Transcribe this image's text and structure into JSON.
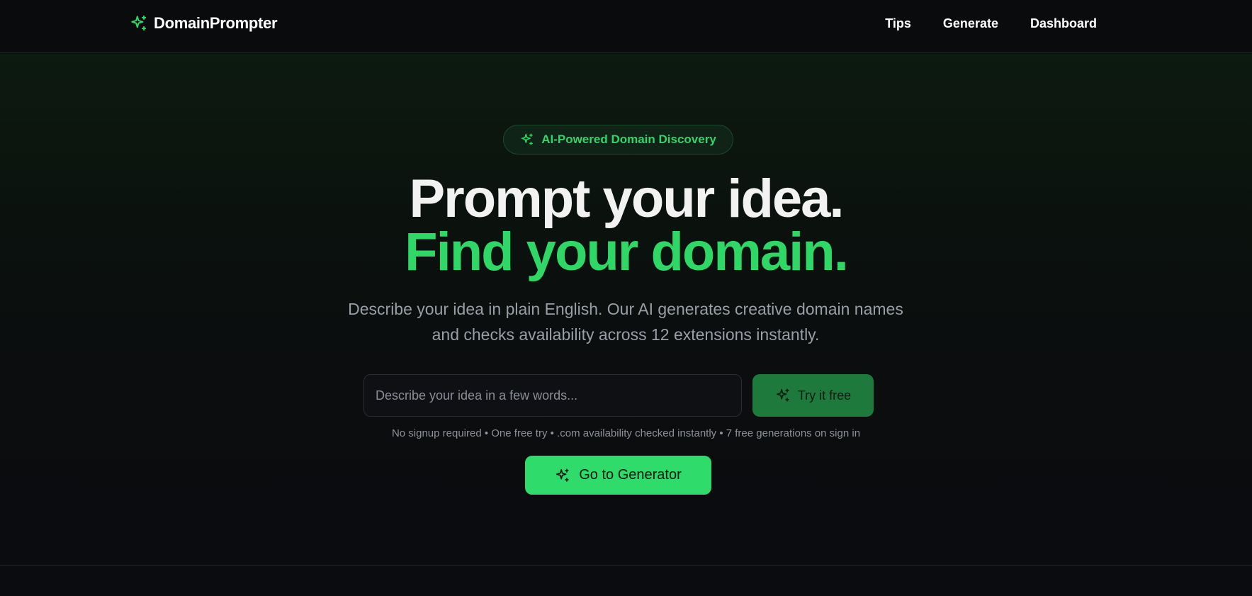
{
  "colors": {
    "accent": "#2fd866",
    "background": "#0b0c0f",
    "muted_text": "#9a9ea6"
  },
  "header": {
    "brand_icon": "sparkles-icon",
    "brand_name": "DomainPrompter",
    "nav": [
      {
        "label": "Tips"
      },
      {
        "label": "Generate"
      },
      {
        "label": "Dashboard"
      }
    ]
  },
  "hero": {
    "badge": {
      "icon": "sparkles-icon",
      "label": "AI-Powered Domain Discovery"
    },
    "headline_line1": "Prompt your idea.",
    "headline_line2": "Find your domain.",
    "subtitle_line1": "Describe your idea in plain English. Our AI generates creative domain names",
    "subtitle_line2": "and checks availability across 12 extensions instantly.",
    "search": {
      "placeholder": "Describe your idea in a few words...",
      "value": ""
    },
    "try_button": {
      "icon": "sparkles-icon",
      "label": "Try it free"
    },
    "hint": "No signup required • One free try • .com availability checked instantly • 7 free generations on sign in",
    "generator_button": {
      "icon": "sparkles-icon",
      "label": "Go to Generator"
    }
  }
}
